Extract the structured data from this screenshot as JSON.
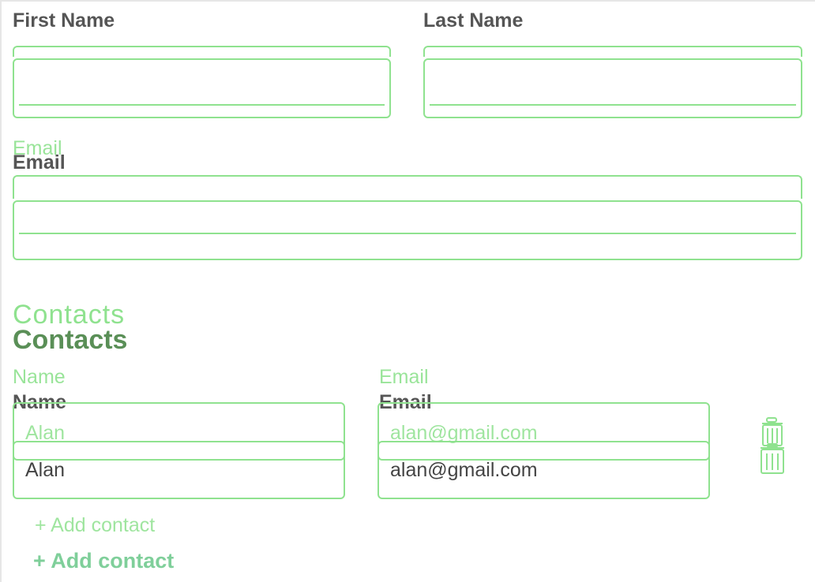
{
  "form": {
    "first_name_label": "First Name",
    "last_name_label": "Last Name",
    "email_label": "Email",
    "first_name_value": "",
    "last_name_value": "",
    "email_value": ""
  },
  "contacts": {
    "title": "Contacts",
    "name_label": "Name",
    "email_label": "Email",
    "rows": [
      {
        "name": "Alan",
        "email": "alan@gmail.com"
      }
    ],
    "add_label": "+ Add contact"
  },
  "colors": {
    "overlay": "#8fe28f",
    "label": "#555555",
    "section": "#5a8f57",
    "add_link": "#7fcf9a"
  },
  "icons": {
    "delete": "trash-icon"
  }
}
